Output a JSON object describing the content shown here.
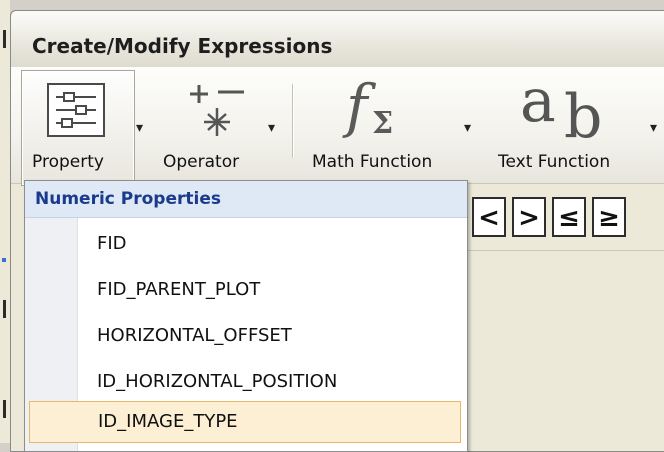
{
  "panel": {
    "title": "Create/Modify Expressions"
  },
  "toolbar": {
    "buttons": [
      {
        "label": "Property",
        "icon": "property-sliders-icon"
      },
      {
        "label": "Operator",
        "icon": "operator-icon"
      },
      {
        "label": "Math Function",
        "icon": "math-function-icon"
      },
      {
        "label": "Text Function",
        "icon": "text-function-icon"
      }
    ],
    "math_glyph": "f",
    "math_sub": "Σ",
    "text_glyph": "a",
    "text_sub": "b"
  },
  "operators": {
    "items": [
      "<",
      ">",
      "≤",
      "≥"
    ]
  },
  "dropdown": {
    "header": "Numeric Properties",
    "items": [
      "FID",
      "FID_PARENT_PLOT",
      "HORIZONTAL_OFFSET",
      "ID_HORIZONTAL_POSITION",
      "ID_IMAGE_TYPE"
    ],
    "highlighted_index": 4,
    "highlight_color": "#fdefd4"
  }
}
